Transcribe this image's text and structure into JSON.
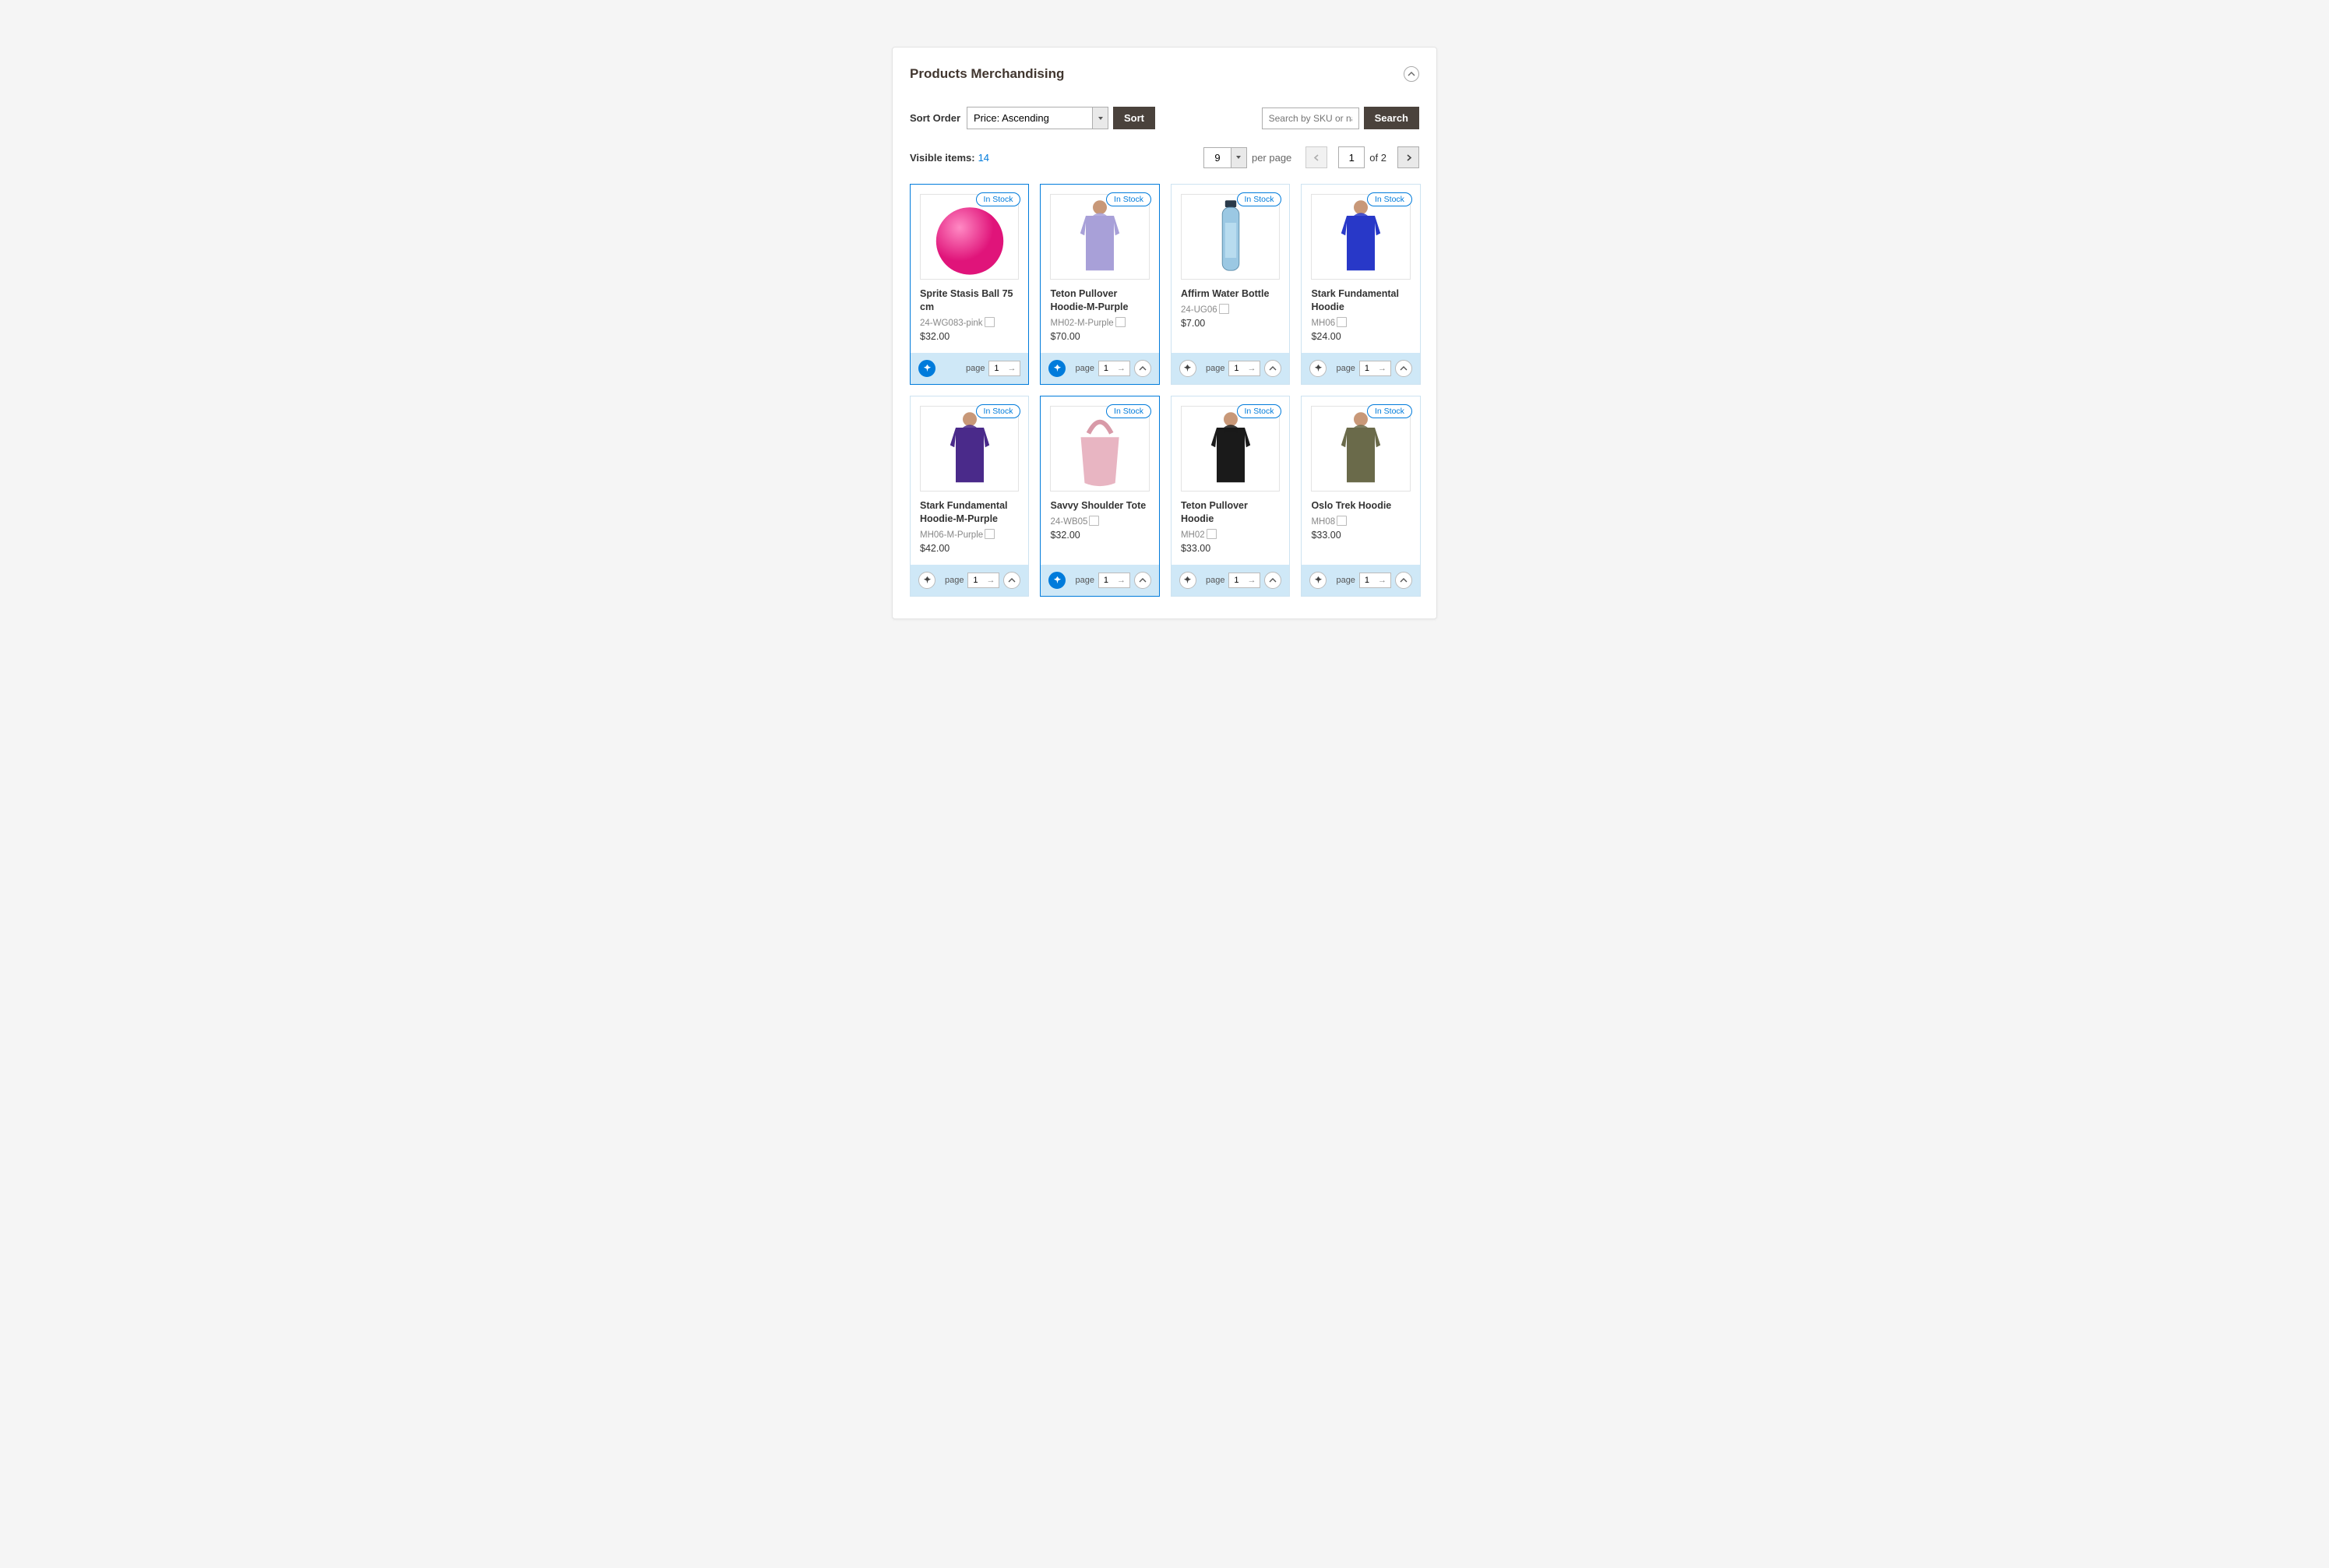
{
  "panel": {
    "title": "Products Merchandising"
  },
  "toolbar": {
    "sort_label": "Sort Order",
    "sort_value": "Price: Ascending",
    "sort_button": "Sort",
    "search_placeholder": "Search by SKU or name",
    "search_button": "Search"
  },
  "meta": {
    "visible_label": "Visible items:",
    "visible_count": "14",
    "per_page_value": "9",
    "per_page_label": "per page",
    "current_page": "1",
    "total_pages": "2",
    "of_label": "of"
  },
  "card_common": {
    "page_label": "page",
    "page_value": "1"
  },
  "products": [
    {
      "name": "Sprite Stasis Ball 75 cm",
      "sku": "24-WG083-pink",
      "price": "$32.00",
      "stock": "In Stock",
      "pinned": true,
      "show_hide": false,
      "image": "ball"
    },
    {
      "name": "Teton Pullover Hoodie-M-Purple",
      "sku": "MH02-M-Purple",
      "price": "$70.00",
      "stock": "In Stock",
      "pinned": true,
      "show_hide": true,
      "image": "hoodie-lilac"
    },
    {
      "name": "Affirm Water Bottle",
      "sku": "24-UG06",
      "price": "$7.00",
      "stock": "In Stock",
      "pinned": false,
      "show_hide": true,
      "image": "bottle"
    },
    {
      "name": "Stark Fundamental Hoodie",
      "sku": "MH06",
      "price": "$24.00",
      "stock": "In Stock",
      "pinned": false,
      "show_hide": true,
      "image": "hoodie-blue"
    },
    {
      "name": "Stark Fundamental Hoodie-M-Purple",
      "sku": "MH06-M-Purple",
      "price": "$42.00",
      "stock": "In Stock",
      "pinned": false,
      "show_hide": true,
      "image": "hoodie-purple"
    },
    {
      "name": "Savvy Shoulder Tote",
      "sku": "24-WB05",
      "price": "$32.00",
      "stock": "In Stock",
      "pinned": true,
      "show_hide": true,
      "image": "tote"
    },
    {
      "name": "Teton Pullover Hoodie",
      "sku": "MH02",
      "price": "$33.00",
      "stock": "In Stock",
      "pinned": false,
      "show_hide": true,
      "image": "hoodie-black"
    },
    {
      "name": "Oslo Trek Hoodie",
      "sku": "MH08",
      "price": "$33.00",
      "stock": "In Stock",
      "pinned": false,
      "show_hide": true,
      "image": "hoodie-olive"
    }
  ]
}
